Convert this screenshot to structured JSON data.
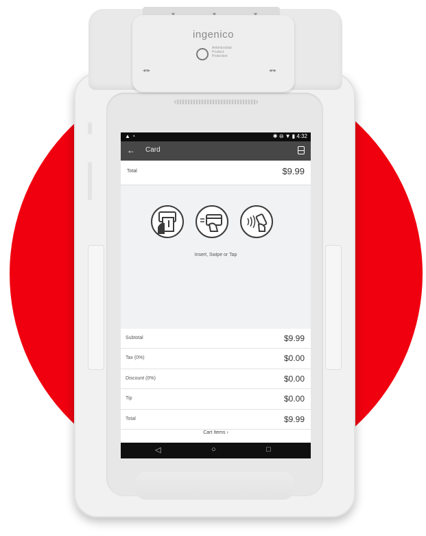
{
  "device": {
    "brand": "ingenico",
    "protection_text": "Antimicrobial Product Protection",
    "accent_color": "#f0000f"
  },
  "statusbar": {
    "left_icons": "▲ ◔",
    "right_icons": "✱ ⊖ ▼ ▮",
    "time": "4:32"
  },
  "appbar": {
    "back_icon": "←",
    "title": "Card"
  },
  "summary": {
    "total_label": "Total",
    "total_value": "$9.99"
  },
  "payment": {
    "methods": [
      "insert-card-icon",
      "swipe-card-icon",
      "contactless-tap-icon"
    ],
    "caption": "Insert, Swipe or Tap"
  },
  "breakdown": [
    {
      "label": "Subtotal",
      "value": "$9.99"
    },
    {
      "label": "Tax (0%)",
      "value": "$0.00"
    },
    {
      "label": "Discount (0%)",
      "value": "$0.00"
    },
    {
      "label": "Tip",
      "value": "$0.00"
    },
    {
      "label": "Total",
      "value": "$9.99"
    }
  ],
  "cart_link": "Cart Items ›",
  "navbar": {
    "back": "◁",
    "home": "○",
    "recents": "□"
  }
}
